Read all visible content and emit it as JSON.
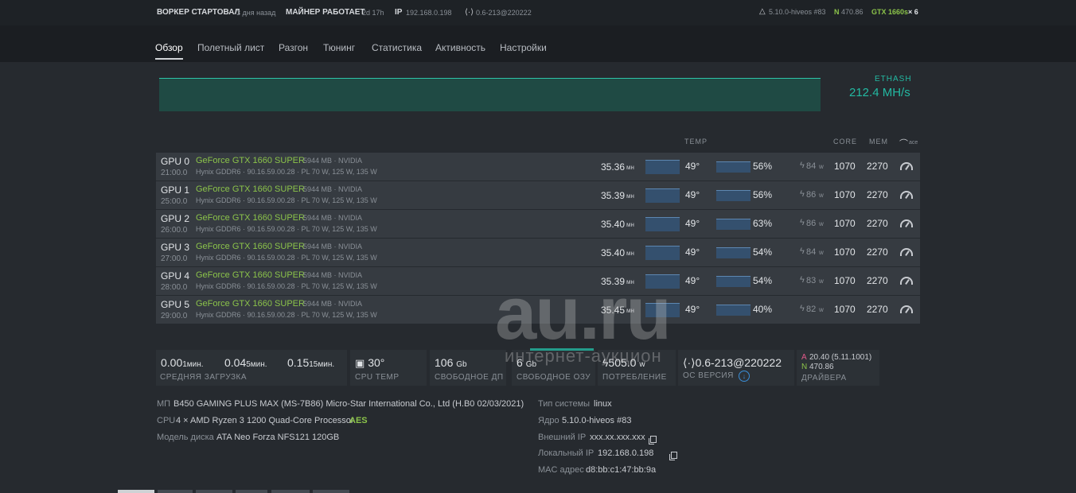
{
  "topbar": {
    "worker_started_label": "ВОРКЕР СТАРТОВАЛ",
    "worker_started_value": "3 дня назад",
    "miner_label": "МАЙНЕР РАБОТАЕТ",
    "miner_value": "2d 17h",
    "ip_label": "IP",
    "ip_value": "192.168.0.198",
    "version": "0.6-213@220222",
    "kernel": "5.10.0-hiveos #83",
    "n_label": "N",
    "n_value": "470.86",
    "gpu_summary": "GTX 1660s",
    "gpu_count": "× 6"
  },
  "tabs": [
    "Обзор",
    "Полетный лист",
    "Разгон",
    "Тюнинг",
    "Статистика",
    "Активность",
    "Настройки"
  ],
  "hashrate": {
    "algo": "ETHASH",
    "value": "212.4 MH/s"
  },
  "table_headers": {
    "temp": "TEMP",
    "core": "CORE",
    "mem": "MEM",
    "oc": "ace"
  },
  "gpus": [
    {
      "name": "GPU 0",
      "time": "21:00.0",
      "model": "GeForce GTX 1660 SUPER",
      "mem": "5944 MB · NVIDIA",
      "details": "Hynix GDDR6 · 90.16.59.00.28 · PL 70 W, 125 W, 135 W",
      "hash": "35.36",
      "unit": "мн",
      "temp": "49°",
      "fan": "56%",
      "power": "84",
      "w": "w",
      "core": "1070",
      "memclk": "2270"
    },
    {
      "name": "GPU 1",
      "time": "25:00.0",
      "model": "GeForce GTX 1660 SUPER",
      "mem": "5944 MB · NVIDIA",
      "details": "Hynix GDDR6 · 90.16.59.00.28 · PL 70 W, 125 W, 135 W",
      "hash": "35.39",
      "unit": "мн",
      "temp": "49°",
      "fan": "56%",
      "power": "86",
      "w": "w",
      "core": "1070",
      "memclk": "2270"
    },
    {
      "name": "GPU 2",
      "time": "26:00.0",
      "model": "GeForce GTX 1660 SUPER",
      "mem": "5944 MB · NVIDIA",
      "details": "Hynix GDDR6 · 90.16.59.00.28 · PL 70 W, 125 W, 135 W",
      "hash": "35.40",
      "unit": "мн",
      "temp": "49°",
      "fan": "63%",
      "power": "86",
      "w": "w",
      "core": "1070",
      "memclk": "2270"
    },
    {
      "name": "GPU 3",
      "time": "27:00.0",
      "model": "GeForce GTX 1660 SUPER",
      "mem": "5944 MB · NVIDIA",
      "details": "Hynix GDDR6 · 90.16.59.00.28 · PL 70 W, 125 W, 135 W",
      "hash": "35.40",
      "unit": "мн",
      "temp": "49°",
      "fan": "54%",
      "power": "84",
      "w": "w",
      "core": "1070",
      "memclk": "2270"
    },
    {
      "name": "GPU 4",
      "time": "28:00.0",
      "model": "GeForce GTX 1660 SUPER",
      "mem": "5944 MB · NVIDIA",
      "details": "Hynix GDDR6 · 90.16.59.00.28 · PL 70 W, 125 W, 135 W",
      "hash": "35.39",
      "unit": "мн",
      "temp": "49°",
      "fan": "54%",
      "power": "83",
      "w": "w",
      "core": "1070",
      "memclk": "2270"
    },
    {
      "name": "GPU 5",
      "time": "29:00.0",
      "model": "GeForce GTX 1660 SUPER",
      "mem": "5944 MB · NVIDIA",
      "details": "Hynix GDDR6 · 90.16.59.00.28 · PL 70 W, 125 W, 135 W",
      "hash": "35.45",
      "unit": "мн",
      "temp": "49°",
      "fan": "40%",
      "power": "82",
      "w": "w",
      "core": "1070",
      "memclk": "2270"
    }
  ],
  "stats": {
    "load_1": "0.00",
    "load_1_unit": "1мин.",
    "load_5": "0.04",
    "load_5_unit": "5мин.",
    "load_15": "0.15",
    "load_15_unit": "15мин.",
    "load_label": "СРЕДНЯЯ ЗАГРУЗКА",
    "cpu_temp": "30°",
    "cpu_temp_label": "CPU TEMP",
    "disk": "106",
    "disk_unit": "Gb",
    "disk_label": "СВОБОДНОЕ ДП",
    "ram": "6",
    "ram_unit": "Gb",
    "ram_label": "СВОБОДНОЕ ОЗУ",
    "power": "505.0",
    "power_unit": "w",
    "power_label": "ПОТРЕБЛЕНИЕ",
    "os_version": "0.6-213@220222",
    "os_label": "ОС ВЕРСИЯ",
    "driver_a_label": "A",
    "driver_a": "20.40 (5.11.1001)",
    "driver_n_label": "N",
    "driver_n": "470.86",
    "drivers_label": "ДРАЙВЕРА"
  },
  "system_info": {
    "mb_label": "МП",
    "mb_value": "B450 GAMING PLUS MAX (MS-7B86) Micro-Star International Co., Ltd (H.B0 02/03/2021)",
    "cpu_label": "CPU",
    "cpu_value": "4 × AMD Ryzen 3 1200 Quad-Core Processor",
    "cpu_flag": "AES",
    "disk_label": "Модель диска",
    "disk_value": "ATA Neo Forza NFS121 120GB",
    "os_type_label": "Тип системы",
    "os_type_value": "linux",
    "kernel_label": "Ядро",
    "kernel_value": "5.10.0-hiveos #83",
    "ext_ip_label": "Внешний IP",
    "ext_ip_value": "xxx.xx.xxx.xxx",
    "local_ip_label": "Локальный IP",
    "local_ip_value": "192.168.0.198",
    "mac_label": "MAC адрес",
    "mac_value": "d8:bb:c1:47:bb:9a"
  },
  "watermark": {
    "main": "au.ru",
    "sub": "интернет-аукцион"
  }
}
